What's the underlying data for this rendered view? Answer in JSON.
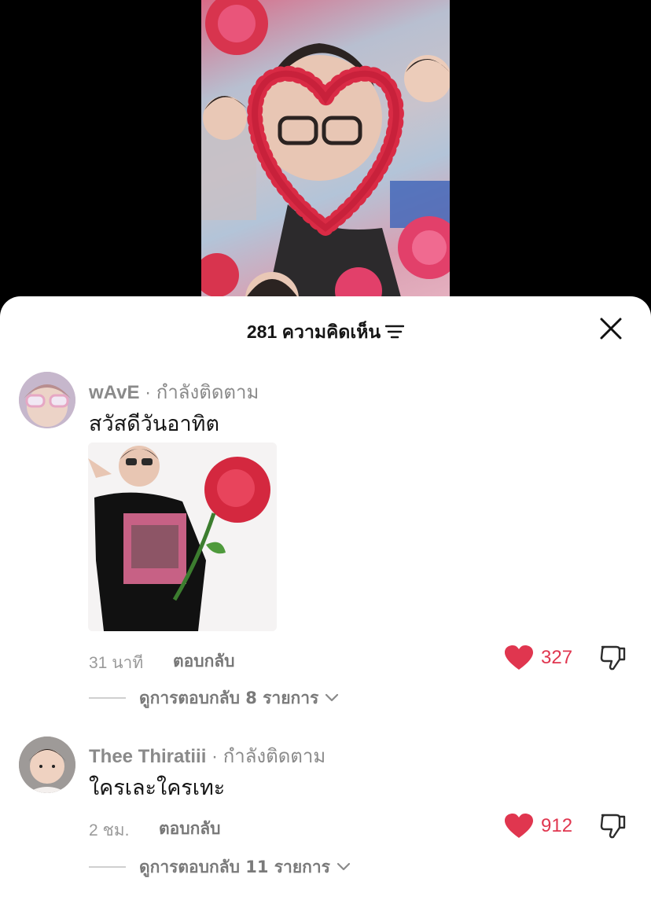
{
  "header": {
    "comment_count_label": "281 ความคิดเห็น",
    "filter_icon": "filter-icon",
    "close_icon": "close-icon"
  },
  "colors": {
    "like": "#e0364f",
    "sheet_bg": "#ffffff",
    "muted_text": "#8a8a8a"
  },
  "comments": [
    {
      "author": "wAvE",
      "follow_status": " · กำลังติดตาม",
      "text": "สวัสดีวันอาทิต",
      "has_image": true,
      "time": "31 นาที",
      "reply_label": "ตอบกลับ",
      "likes": "327",
      "view_replies": "ดูการตอบกลับ 8 รายการ"
    },
    {
      "author": "Thee Thiratiii",
      "follow_status": " · กำลังติดตาม",
      "text": "ใครเละใครเทะ",
      "has_image": false,
      "time": "2 ชม.",
      "reply_label": "ตอบกลับ",
      "likes": "912",
      "view_replies": "ดูการตอบกลับ 11 รายการ"
    }
  ]
}
